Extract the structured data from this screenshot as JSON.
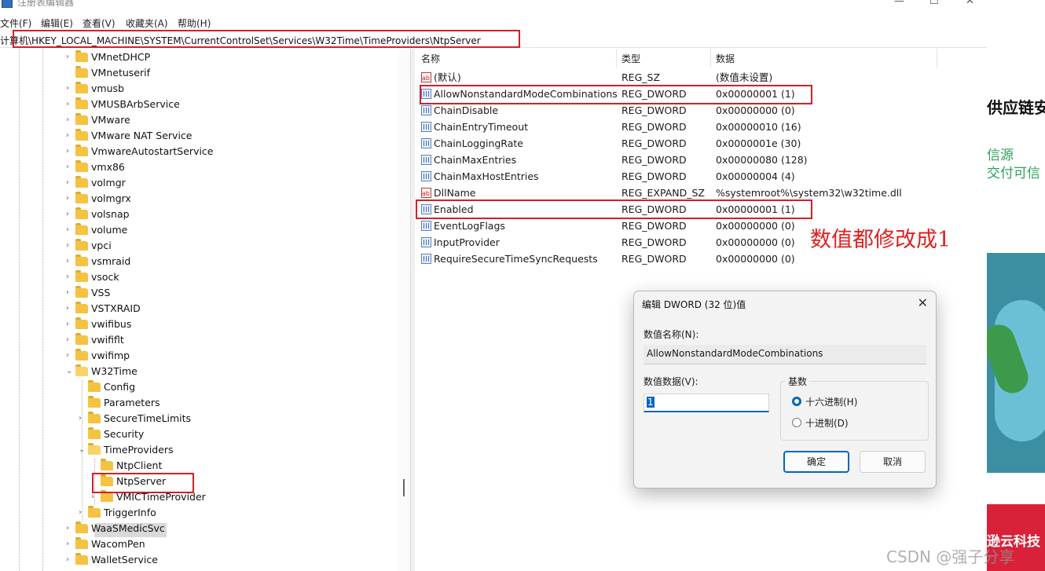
{
  "window": {
    "title": "注册表编辑器",
    "controls": {
      "minimize": "—",
      "maximize": "☐",
      "close": "✕"
    }
  },
  "menu": [
    "文件(F)",
    "编辑(E)",
    "查看(V)",
    "收藏夹(A)",
    "帮助(H)"
  ],
  "address": "计算机\\HKEY_LOCAL_MACHINE\\SYSTEM\\CurrentControlSet\\Services\\W32Time\\TimeProviders\\NtpServer",
  "tree": [
    {
      "label": "VMnetDHCP",
      "chevron": "›"
    },
    {
      "label": "VMnetuserif",
      "chevron": ""
    },
    {
      "label": "vmusb",
      "chevron": "›"
    },
    {
      "label": "VMUSBArbService",
      "chevron": "›"
    },
    {
      "label": "VMware",
      "chevron": "›"
    },
    {
      "label": "VMware NAT Service",
      "chevron": "›"
    },
    {
      "label": "VmwareAutostartService",
      "chevron": "›"
    },
    {
      "label": "vmx86",
      "chevron": "›"
    },
    {
      "label": "volmgr",
      "chevron": "›"
    },
    {
      "label": "volmgrx",
      "chevron": "›"
    },
    {
      "label": "volsnap",
      "chevron": "›"
    },
    {
      "label": "volume",
      "chevron": "›"
    },
    {
      "label": "vpci",
      "chevron": "›"
    },
    {
      "label": "vsmraid",
      "chevron": "›"
    },
    {
      "label": "vsock",
      "chevron": "›"
    },
    {
      "label": "VSS",
      "chevron": "›"
    },
    {
      "label": "VSTXRAID",
      "chevron": "›"
    },
    {
      "label": "vwifibus",
      "chevron": "›"
    },
    {
      "label": "vwififlt",
      "chevron": "›"
    },
    {
      "label": "vwifimp",
      "chevron": "›"
    },
    {
      "label": "W32Time",
      "chevron": "⌄"
    },
    {
      "label": "Config",
      "chevron": ""
    },
    {
      "label": "Parameters",
      "chevron": ""
    },
    {
      "label": "SecureTimeLimits",
      "chevron": "›"
    },
    {
      "label": "Security",
      "chevron": ""
    },
    {
      "label": "TimeProviders",
      "chevron": "⌄"
    },
    {
      "label": "NtpClient",
      "chevron": ""
    },
    {
      "label": "NtpServer",
      "chevron": ""
    },
    {
      "label": "VMICTimeProvider",
      "chevron": "›"
    },
    {
      "label": "TriggerInfo",
      "chevron": "›"
    },
    {
      "label": "WaaSMedicSvc",
      "chevron": "›"
    },
    {
      "label": "WacomPen",
      "chevron": "›"
    },
    {
      "label": "WalletService",
      "chevron": "›"
    }
  ],
  "columns": {
    "name": "名称",
    "type": "类型",
    "data": "数据"
  },
  "values": [
    {
      "name": "(默认)",
      "type": "REG_SZ",
      "data": "(数值未设置)",
      "icon": "ab"
    },
    {
      "name": "AllowNonstandardModeCombinations",
      "type": "REG_DWORD",
      "data": "0x00000001 (1)",
      "icon": "dword"
    },
    {
      "name": "ChainDisable",
      "type": "REG_DWORD",
      "data": "0x00000000 (0)",
      "icon": "dword"
    },
    {
      "name": "ChainEntryTimeout",
      "type": "REG_DWORD",
      "data": "0x00000010 (16)",
      "icon": "dword"
    },
    {
      "name": "ChainLoggingRate",
      "type": "REG_DWORD",
      "data": "0x0000001e (30)",
      "icon": "dword"
    },
    {
      "name": "ChainMaxEntries",
      "type": "REG_DWORD",
      "data": "0x00000080 (128)",
      "icon": "dword"
    },
    {
      "name": "ChainMaxHostEntries",
      "type": "REG_DWORD",
      "data": "0x00000004 (4)",
      "icon": "dword"
    },
    {
      "name": "DllName",
      "type": "REG_EXPAND_SZ",
      "data": "%systemroot%\\system32\\w32time.dll",
      "icon": "ab"
    },
    {
      "name": "Enabled",
      "type": "REG_DWORD",
      "data": "0x00000001 (1)",
      "icon": "dword"
    },
    {
      "name": "EventLogFlags",
      "type": "REG_DWORD",
      "data": "0x00000000 (0)",
      "icon": "dword"
    },
    {
      "name": "InputProvider",
      "type": "REG_DWORD",
      "data": "0x00000000 (0)",
      "icon": "dword"
    },
    {
      "name": "RequireSecureTimeSyncRequests",
      "type": "REG_DWORD",
      "data": "0x00000000 (0)",
      "icon": "dword"
    }
  ],
  "annotation": "数值都修改成1",
  "dialog": {
    "title": "编辑 DWORD (32 位)值",
    "close": "✕",
    "name_label": "数值名称(N):",
    "name_value": "AllowNonstandardModeCombinations",
    "data_label": "数值数据(V):",
    "data_value": "1",
    "base_label": "基数",
    "hex_label": "十六进制(H)",
    "dec_label": "十进制(D)",
    "base_selected": "十六进制(H)",
    "ok": "确定",
    "cancel": "取消"
  },
  "background_app": {
    "line1": "供应链安",
    "line2": "信源",
    "line3": "交付可信",
    "line4": "逊云科技"
  },
  "watermark": "CSDN @强子分享"
}
